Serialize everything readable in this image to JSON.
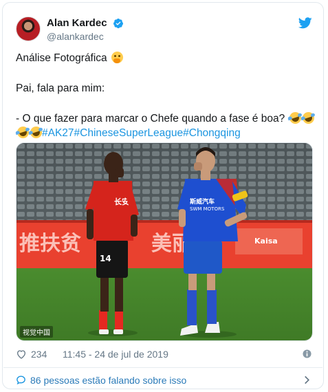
{
  "author": {
    "display_name": "Alan Kardec",
    "handle": "@alankardec",
    "verified": true,
    "avatar_icon": "avatar-photo"
  },
  "tweet": {
    "line_1": "Análise Fotográfica",
    "line_2": "Pai, fala para mim:",
    "line_3": "- O que fazer para marcar o Chefe quando a fase é boa?",
    "hashtags": [
      "#AK27",
      "#ChineseSuperLeague",
      "#Chongqing"
    ],
    "emojis": {
      "line_1": "thinking-face",
      "line_3": [
        "rolling-laughing",
        "rolling-laughing",
        "rolling-laughing",
        "rolling-laughing"
      ]
    }
  },
  "photo": {
    "watermark": "视觉中国",
    "jersey_left_number": "14"
  },
  "meta": {
    "likes": "234",
    "timestamp": "11:45 - 24 de jul de 2019"
  },
  "footer": {
    "conversation": "86 pessoas estão falando sobre isso"
  },
  "colors": {
    "link": "#1b95e0",
    "text": "#14171a",
    "secondary": "#657786",
    "border": "#e1e8ed"
  }
}
